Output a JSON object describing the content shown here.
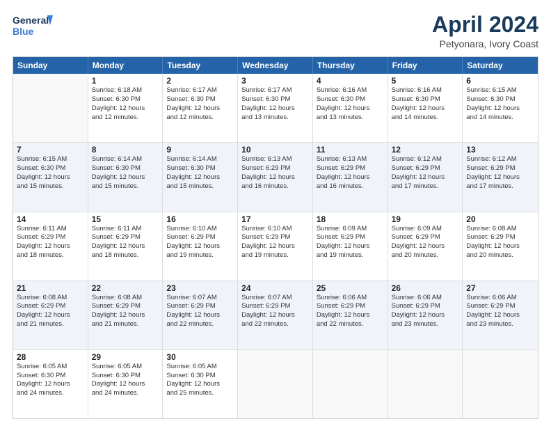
{
  "header": {
    "logo_line1": "General",
    "logo_line2": "Blue",
    "title": "April 2024",
    "subtitle": "Petyonara, Ivory Coast"
  },
  "weekdays": [
    "Sunday",
    "Monday",
    "Tuesday",
    "Wednesday",
    "Thursday",
    "Friday",
    "Saturday"
  ],
  "rows": [
    {
      "alt": false,
      "cells": [
        {
          "day": "",
          "info": ""
        },
        {
          "day": "1",
          "info": "Sunrise: 6:18 AM\nSunset: 6:30 PM\nDaylight: 12 hours\nand 12 minutes."
        },
        {
          "day": "2",
          "info": "Sunrise: 6:17 AM\nSunset: 6:30 PM\nDaylight: 12 hours\nand 12 minutes."
        },
        {
          "day": "3",
          "info": "Sunrise: 6:17 AM\nSunset: 6:30 PM\nDaylight: 12 hours\nand 13 minutes."
        },
        {
          "day": "4",
          "info": "Sunrise: 6:16 AM\nSunset: 6:30 PM\nDaylight: 12 hours\nand 13 minutes."
        },
        {
          "day": "5",
          "info": "Sunrise: 6:16 AM\nSunset: 6:30 PM\nDaylight: 12 hours\nand 14 minutes."
        },
        {
          "day": "6",
          "info": "Sunrise: 6:15 AM\nSunset: 6:30 PM\nDaylight: 12 hours\nand 14 minutes."
        }
      ]
    },
    {
      "alt": true,
      "cells": [
        {
          "day": "7",
          "info": "Sunrise: 6:15 AM\nSunset: 6:30 PM\nDaylight: 12 hours\nand 15 minutes."
        },
        {
          "day": "8",
          "info": "Sunrise: 6:14 AM\nSunset: 6:30 PM\nDaylight: 12 hours\nand 15 minutes."
        },
        {
          "day": "9",
          "info": "Sunrise: 6:14 AM\nSunset: 6:30 PM\nDaylight: 12 hours\nand 15 minutes."
        },
        {
          "day": "10",
          "info": "Sunrise: 6:13 AM\nSunset: 6:29 PM\nDaylight: 12 hours\nand 16 minutes."
        },
        {
          "day": "11",
          "info": "Sunrise: 6:13 AM\nSunset: 6:29 PM\nDaylight: 12 hours\nand 16 minutes."
        },
        {
          "day": "12",
          "info": "Sunrise: 6:12 AM\nSunset: 6:29 PM\nDaylight: 12 hours\nand 17 minutes."
        },
        {
          "day": "13",
          "info": "Sunrise: 6:12 AM\nSunset: 6:29 PM\nDaylight: 12 hours\nand 17 minutes."
        }
      ]
    },
    {
      "alt": false,
      "cells": [
        {
          "day": "14",
          "info": "Sunrise: 6:11 AM\nSunset: 6:29 PM\nDaylight: 12 hours\nand 18 minutes."
        },
        {
          "day": "15",
          "info": "Sunrise: 6:11 AM\nSunset: 6:29 PM\nDaylight: 12 hours\nand 18 minutes."
        },
        {
          "day": "16",
          "info": "Sunrise: 6:10 AM\nSunset: 6:29 PM\nDaylight: 12 hours\nand 19 minutes."
        },
        {
          "day": "17",
          "info": "Sunrise: 6:10 AM\nSunset: 6:29 PM\nDaylight: 12 hours\nand 19 minutes."
        },
        {
          "day": "18",
          "info": "Sunrise: 6:09 AM\nSunset: 6:29 PM\nDaylight: 12 hours\nand 19 minutes."
        },
        {
          "day": "19",
          "info": "Sunrise: 6:09 AM\nSunset: 6:29 PM\nDaylight: 12 hours\nand 20 minutes."
        },
        {
          "day": "20",
          "info": "Sunrise: 6:08 AM\nSunset: 6:29 PM\nDaylight: 12 hours\nand 20 minutes."
        }
      ]
    },
    {
      "alt": true,
      "cells": [
        {
          "day": "21",
          "info": "Sunrise: 6:08 AM\nSunset: 6:29 PM\nDaylight: 12 hours\nand 21 minutes."
        },
        {
          "day": "22",
          "info": "Sunrise: 6:08 AM\nSunset: 6:29 PM\nDaylight: 12 hours\nand 21 minutes."
        },
        {
          "day": "23",
          "info": "Sunrise: 6:07 AM\nSunset: 6:29 PM\nDaylight: 12 hours\nand 22 minutes."
        },
        {
          "day": "24",
          "info": "Sunrise: 6:07 AM\nSunset: 6:29 PM\nDaylight: 12 hours\nand 22 minutes."
        },
        {
          "day": "25",
          "info": "Sunrise: 6:06 AM\nSunset: 6:29 PM\nDaylight: 12 hours\nand 22 minutes."
        },
        {
          "day": "26",
          "info": "Sunrise: 6:06 AM\nSunset: 6:29 PM\nDaylight: 12 hours\nand 23 minutes."
        },
        {
          "day": "27",
          "info": "Sunrise: 6:06 AM\nSunset: 6:29 PM\nDaylight: 12 hours\nand 23 minutes."
        }
      ]
    },
    {
      "alt": false,
      "cells": [
        {
          "day": "28",
          "info": "Sunrise: 6:05 AM\nSunset: 6:30 PM\nDaylight: 12 hours\nand 24 minutes."
        },
        {
          "day": "29",
          "info": "Sunrise: 6:05 AM\nSunset: 6:30 PM\nDaylight: 12 hours\nand 24 minutes."
        },
        {
          "day": "30",
          "info": "Sunrise: 6:05 AM\nSunset: 6:30 PM\nDaylight: 12 hours\nand 25 minutes."
        },
        {
          "day": "",
          "info": ""
        },
        {
          "day": "",
          "info": ""
        },
        {
          "day": "",
          "info": ""
        },
        {
          "day": "",
          "info": ""
        }
      ]
    }
  ]
}
